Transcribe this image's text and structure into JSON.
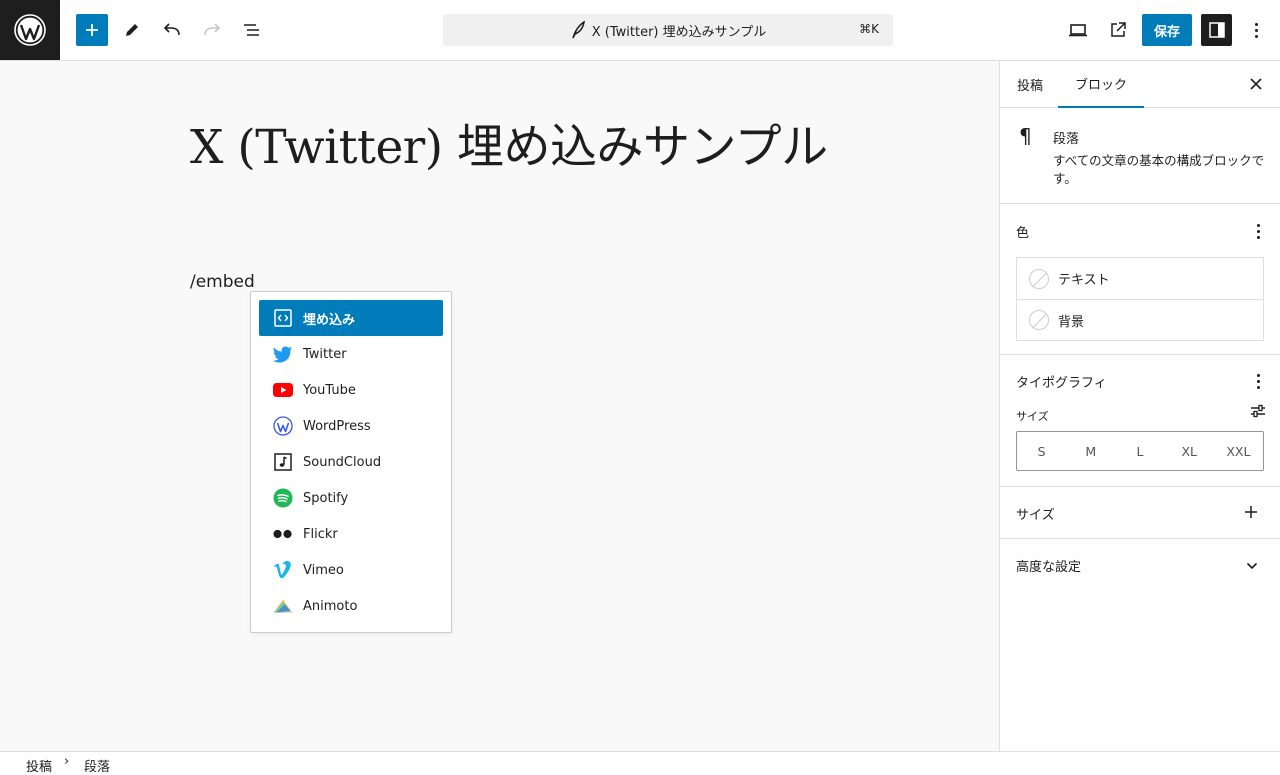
{
  "header": {
    "document_title": "X (Twitter) 埋め込みサンプル",
    "shortcut": "⌘K",
    "save_label": "保存"
  },
  "editor": {
    "post_title": "X (Twitter) 埋め込みサンプル",
    "paragraph_text": "/embed"
  },
  "inserter": {
    "items": [
      {
        "label": "埋め込み",
        "icon": "embed-generic-icon",
        "selected": true
      },
      {
        "label": "Twitter",
        "icon": "twitter-icon"
      },
      {
        "label": "YouTube",
        "icon": "youtube-icon"
      },
      {
        "label": "WordPress",
        "icon": "wordpress-icon"
      },
      {
        "label": "SoundCloud",
        "icon": "soundcloud-icon"
      },
      {
        "label": "Spotify",
        "icon": "spotify-icon"
      },
      {
        "label": "Flickr",
        "icon": "flickr-icon"
      },
      {
        "label": "Vimeo",
        "icon": "vimeo-icon"
      },
      {
        "label": "Animoto",
        "icon": "animoto-icon"
      }
    ]
  },
  "sidebar": {
    "tab_post": "投稿",
    "tab_block": "ブロック",
    "block_name": "段落",
    "block_description": "すべての文章の基本の構成ブロックです。",
    "color_panel": {
      "title": "色",
      "text_label": "テキスト",
      "background_label": "背景"
    },
    "typography_panel": {
      "title": "タイポグラフィ",
      "size_label": "サイズ",
      "sizes": [
        "S",
        "M",
        "L",
        "XL",
        "XXL"
      ]
    },
    "dimensions_panel_title": "サイズ",
    "advanced_panel_title": "高度な設定"
  },
  "breadcrumb": {
    "root": "投稿",
    "current": "段落"
  },
  "colors": {
    "accent": "#007cba",
    "dark": "#1e1e1e",
    "twitter": "#1d9bf0",
    "youtube": "#ff0000",
    "spotify": "#1db954",
    "vimeo": "#1ab7ea",
    "wordpress": "#3858e9"
  }
}
